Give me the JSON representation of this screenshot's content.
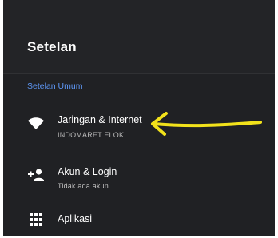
{
  "header": {
    "title": "Setelan"
  },
  "section": {
    "title": "Setelan Umum"
  },
  "items": [
    {
      "title": "Jaringan & Internet",
      "subtitle": "INDOMARET ELOK",
      "icon": "wifi-icon"
    },
    {
      "title": "Akun & Login",
      "subtitle": "Tidak ada akun",
      "icon": "add-person-icon"
    },
    {
      "title": "Aplikasi",
      "icon": "apps-grid-icon"
    }
  ],
  "annotation": {
    "type": "hand-drawn arrow",
    "color": "#f2e21b",
    "points_to": "Jaringan & Internet"
  },
  "colors": {
    "background": "#202124",
    "accent": "#5e97f6",
    "text": "#ffffff",
    "subtext": "#bdbdbd"
  }
}
